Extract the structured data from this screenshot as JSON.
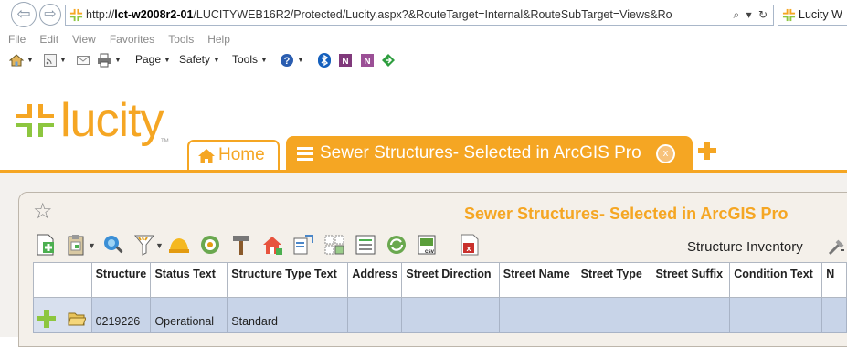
{
  "browser": {
    "url_prefix": "http://",
    "url_host": "lct-w2008r2-01",
    "url_path": "/LUCITYWEB16R2/Protected/Lucity.aspx?&RouteTarget=Internal&RouteSubTarget=Views&Ro",
    "url_tools": "⌕ ▾ ↻",
    "tab_title": "Lucity W",
    "menu": [
      "File",
      "Edit",
      "View",
      "Favorites",
      "Tools",
      "Help"
    ],
    "commands": {
      "page": "Page",
      "safety": "Safety",
      "tools": "Tools"
    }
  },
  "app": {
    "logo_text": "lucity",
    "logo_tm": "TM",
    "brand_color": "#f5a623",
    "tabs": [
      {
        "label": "Home",
        "active": false
      },
      {
        "label": "Sewer Structures- Selected in ArcGIS Pro",
        "active": true,
        "close": "x"
      }
    ]
  },
  "grid": {
    "title": "Sewer Structures- Selected in ArcGIS Pro",
    "view_name": "Structure Inventory",
    "toolbar_icons": [
      "new-record-icon",
      "clipboard-icon",
      "map-zoom-icon",
      "filter-icon",
      "hardhat-icon",
      "refresh-status-icon",
      "hammer-icon",
      "home-flag-icon",
      "document-edit-icon",
      "copy-fields-icon",
      "report-icon",
      "sync-icon",
      "export-csv-icon",
      "pdf-icon"
    ],
    "columns": [
      "",
      "Structure",
      "Status Text",
      "Structure Type Text",
      "Address",
      "Street Direction",
      "Street Name",
      "Street Type",
      "Street Suffix",
      "Condition Text",
      "N"
    ],
    "rows": [
      {
        "structure": "0219226",
        "status": "Operational",
        "type": "Standard",
        "address": "",
        "street_direction": "",
        "street_name": "",
        "street_type": "",
        "street_suffix": "",
        "condition": "",
        "n": ""
      }
    ]
  }
}
